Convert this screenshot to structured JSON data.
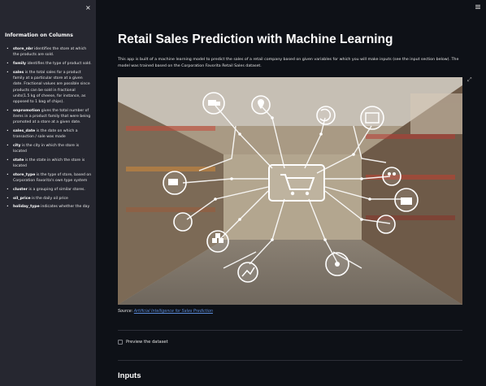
{
  "sidebar": {
    "close_icon": "×",
    "title": "Information on Columns",
    "items": [
      {
        "term": "store_nbr",
        "text": " identifies the store at which the products are sold."
      },
      {
        "term": "family",
        "text": " identifies the type of product sold."
      },
      {
        "term": "sales",
        "text": " is the total sales for a product family at a particular store at a given date. Fractional values are possible since products can be sold in fractional units(1.5 kg of cheese, for instance, as opposed to 1 bag of chips)."
      },
      {
        "term": "onpromotion",
        "text": " gives the total number of items in a product family that were being promoted at a store at a given date."
      },
      {
        "term": "sales_date",
        "text": " is the date on which a transaction / sale was made"
      },
      {
        "term": "city",
        "text": " is the city in which the store is located"
      },
      {
        "term": "state",
        "text": " is the state in which the store is located"
      },
      {
        "term": "store_type",
        "text": " is the type of store, based on Corporation Favorita's own type system"
      },
      {
        "term": "cluster",
        "text": " is a grouping of similar stores."
      },
      {
        "term": "oil_price",
        "text": " is the daily oil price"
      },
      {
        "term": "holiday_type",
        "text": " indicates whether the day"
      }
    ]
  },
  "main": {
    "menu_icon": "hamburger-menu-icon",
    "title": "Retail Sales Prediction with Machine Learning",
    "description": "This app is built of a machine learning model to predict the sales of a retail company based on given variables for which you will make inputs (see the input section below). The model was trained based on the Corporation Favorita Retail Sales dataset.",
    "fullscreen_icon": "⤢",
    "hero_icons": [
      "truck-icon",
      "location-pin-icon",
      "refresh-icon",
      "store-icon",
      "forklift-icon",
      "shopping-cart-icon",
      "people-icon",
      "download-box-icon",
      "globe-icon",
      "boxes-icon",
      "chart-icon",
      "network-icon",
      "key-icon"
    ],
    "caption_prefix": "Source: ",
    "caption_link": "Artificial Intelligence for Sales Prediction",
    "checkbox_label": "Preview the dataset",
    "section_title": "Inputs"
  },
  "colors": {
    "app_bg": "#0e1117",
    "sidebar_bg": "#262730",
    "link": "#5b8bd9"
  }
}
